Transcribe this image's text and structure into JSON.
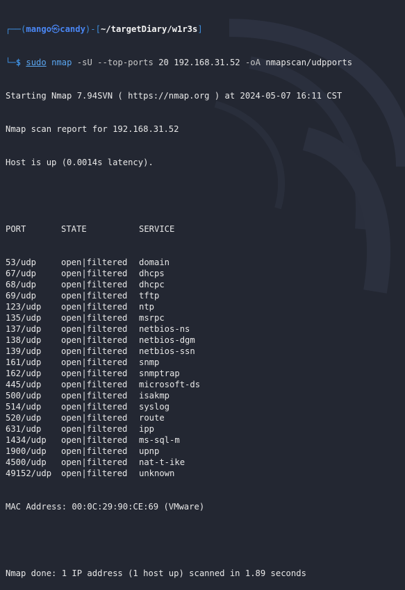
{
  "prompt": {
    "frame_top_left": "┌──(",
    "user": "mango",
    "skull": "㉿",
    "host": "candy",
    "frame_mid": ")-[",
    "path": "~/targetDiary/w1r3s",
    "frame_close": "]",
    "frame_bottom": "└─",
    "symbol": "$",
    "cmd_sudo": "sudo",
    "cmd_nmap": "nmap",
    "opt_sU": "-sU",
    "opt_top": "--top-ports",
    "arg_count": "20",
    "arg_ip": "192.168.31.52",
    "opt_oA": "-oA",
    "arg_out": "nmapscan/udpports"
  },
  "output": {
    "starting": "Starting Nmap 7.94SVN ( https://nmap.org ) at 2024-05-07 16:11 CST",
    "report": "Nmap scan report for 192.168.31.52",
    "host_up": "Host is up (0.0014s latency).",
    "blank": "",
    "header": {
      "port": "PORT",
      "state": "STATE",
      "service": "SERVICE"
    },
    "ports": [
      {
        "port": "53/udp",
        "state": "open|filtered",
        "service": "domain"
      },
      {
        "port": "67/udp",
        "state": "open|filtered",
        "service": "dhcps"
      },
      {
        "port": "68/udp",
        "state": "open|filtered",
        "service": "dhcpc"
      },
      {
        "port": "69/udp",
        "state": "open|filtered",
        "service": "tftp"
      },
      {
        "port": "123/udp",
        "state": "open|filtered",
        "service": "ntp"
      },
      {
        "port": "135/udp",
        "state": "open|filtered",
        "service": "msrpc"
      },
      {
        "port": "137/udp",
        "state": "open|filtered",
        "service": "netbios-ns"
      },
      {
        "port": "138/udp",
        "state": "open|filtered",
        "service": "netbios-dgm"
      },
      {
        "port": "139/udp",
        "state": "open|filtered",
        "service": "netbios-ssn"
      },
      {
        "port": "161/udp",
        "state": "open|filtered",
        "service": "snmp"
      },
      {
        "port": "162/udp",
        "state": "open|filtered",
        "service": "snmptrap"
      },
      {
        "port": "445/udp",
        "state": "open|filtered",
        "service": "microsoft-ds"
      },
      {
        "port": "500/udp",
        "state": "open|filtered",
        "service": "isakmp"
      },
      {
        "port": "514/udp",
        "state": "open|filtered",
        "service": "syslog"
      },
      {
        "port": "520/udp",
        "state": "open|filtered",
        "service": "route"
      },
      {
        "port": "631/udp",
        "state": "open|filtered",
        "service": "ipp"
      },
      {
        "port": "1434/udp",
        "state": "open|filtered",
        "service": "ms-sql-m"
      },
      {
        "port": "1900/udp",
        "state": "open|filtered",
        "service": "upnp"
      },
      {
        "port": "4500/udp",
        "state": "open|filtered",
        "service": "nat-t-ike"
      },
      {
        "port": "49152/udp",
        "state": "open|filtered",
        "service": "unknown"
      }
    ],
    "mac": "MAC Address: 00:0C:29:90:CE:69 (VMware)",
    "done": "Nmap done: 1 IP address (1 host up) scanned in 1.89 seconds"
  },
  "colors": {
    "background": "#232732",
    "frame": "#3e8ede",
    "user": "#4a87f5",
    "command": "#5aa6f0",
    "text": "#e8e8e8"
  }
}
